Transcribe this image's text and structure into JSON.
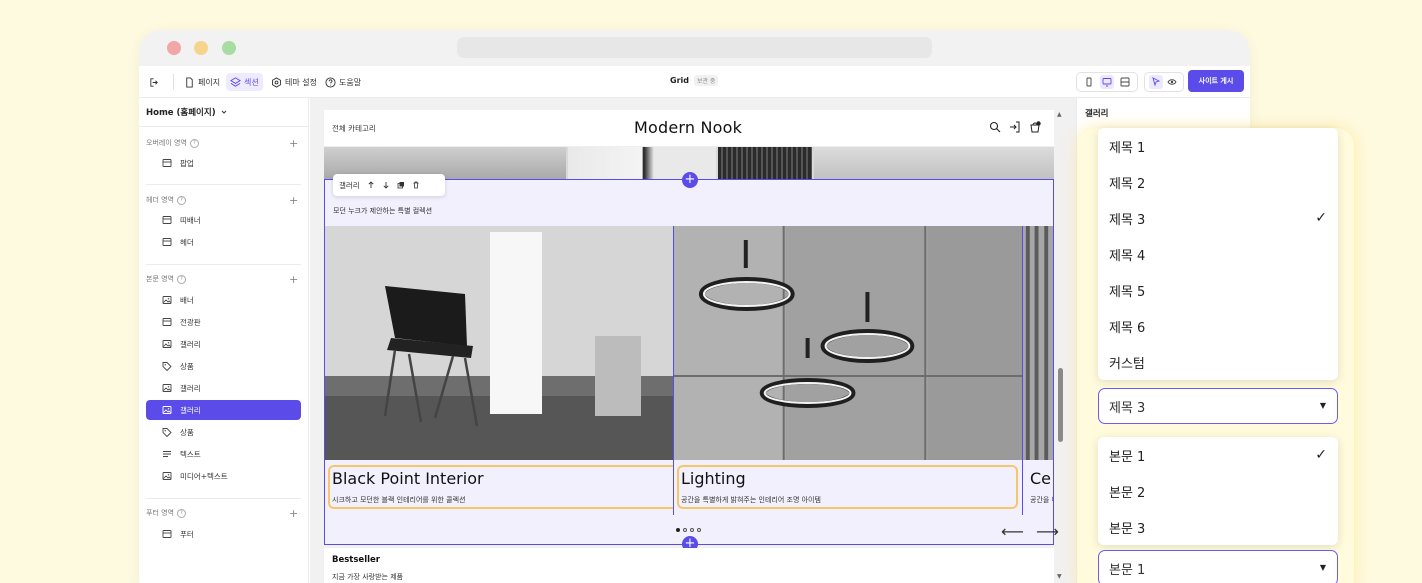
{
  "toolbar": {
    "page_label": "페이지",
    "section_label": "섹션",
    "theme_label": "테마 설정",
    "help_label": "도움말",
    "doc_title": "Grid",
    "status_badge": "보관 중",
    "publish_label": "사이트 게시"
  },
  "sidebar": {
    "home": "Home (홈페이지)",
    "groups": {
      "overlay": "오버레이 영역",
      "header": "헤더 영역",
      "body": "본문 영역",
      "footer": "푸터 영역"
    },
    "overlay_items": [
      {
        "label": "팝업",
        "icon": "layout-icon"
      }
    ],
    "header_items": [
      {
        "label": "띠배너",
        "icon": "layout-icon"
      },
      {
        "label": "헤더",
        "icon": "layout-icon"
      }
    ],
    "body_items": [
      {
        "label": "배너",
        "icon": "image-icon"
      },
      {
        "label": "전광판",
        "icon": "layout-icon"
      },
      {
        "label": "갤러리",
        "icon": "image-icon"
      },
      {
        "label": "상품",
        "icon": "tag-icon"
      },
      {
        "label": "갤러리",
        "icon": "image-icon"
      },
      {
        "label": "갤러리",
        "icon": "image-icon",
        "selected": true
      },
      {
        "label": "상품",
        "icon": "tag-icon"
      },
      {
        "label": "텍스트",
        "icon": "text-icon"
      },
      {
        "label": "미디어+텍스트",
        "icon": "image-icon"
      }
    ],
    "footer_items": [
      {
        "label": "푸터",
        "icon": "layout-icon"
      }
    ]
  },
  "site": {
    "category": "전체 카테고리",
    "brand": "Modern Nook"
  },
  "section": {
    "toolbar_label": "갤러리",
    "subtitle": "모던 누크가 제안하는 특별 컬렉션",
    "cards": [
      {
        "title": "Black Point Interior",
        "desc": "시크하고 모던한 블랙 인테리어를 위한 콜렉션"
      },
      {
        "title": "Lighting",
        "desc": "공간을 특별하게 밝혀주는 인테리어 조명 아이템"
      },
      {
        "title": "Ce",
        "desc": "공간을 아"
      }
    ],
    "slide_count": 4,
    "active_slide": 1
  },
  "bestseller": {
    "title": "Bestseller",
    "subtitle": "지금 가장 사랑받는 제품"
  },
  "right_panel": {
    "title": "갤러리"
  },
  "title_menu": {
    "items": [
      "제목 1",
      "제목 2",
      "제목 3",
      "제목 4",
      "제목 5",
      "제목 6",
      "커스텀"
    ],
    "selected": "제목 3"
  },
  "body_menu": {
    "items": [
      "본문 1",
      "본문 2",
      "본문 3"
    ],
    "selected": "본문 1"
  },
  "colors": {
    "accent": "#5b4be8",
    "highlight": "#f6c66a",
    "page_bg": "#fefae0"
  }
}
